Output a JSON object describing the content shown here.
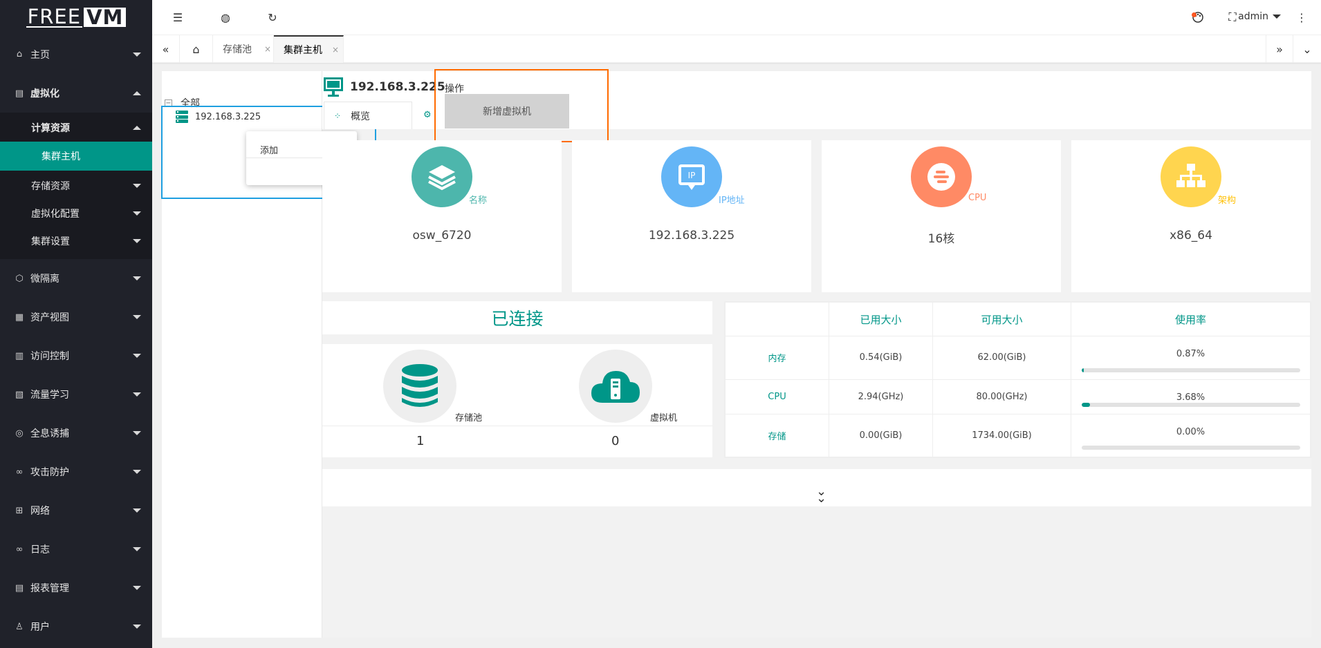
{
  "brand": {
    "part1": "FREE",
    "part2": "VM"
  },
  "sidebar": {
    "items": [
      {
        "label": "主页",
        "icon": "home-icon"
      },
      {
        "label": "虚拟化",
        "icon": "server-icon",
        "expanded": true
      },
      {
        "label": "微隔离",
        "icon": "cube-icon"
      },
      {
        "label": "资产视图",
        "icon": "assets-icon"
      },
      {
        "label": "访问控制",
        "icon": "grid-icon"
      },
      {
        "label": "流量学习",
        "icon": "flow-icon"
      },
      {
        "label": "全息诱捕",
        "icon": "trap-icon"
      },
      {
        "label": "攻击防护",
        "icon": "binoculars-icon"
      },
      {
        "label": "网络",
        "icon": "network-icon"
      },
      {
        "label": "日志",
        "icon": "infinity-icon"
      },
      {
        "label": "报表管理",
        "icon": "report-icon"
      },
      {
        "label": "用户",
        "icon": "user-icon"
      }
    ],
    "sub": {
      "compute": "计算资源",
      "cluster_host": "集群主机",
      "storage": "存储资源",
      "virt_config": "虚拟化配置",
      "cluster_settings": "集群设置"
    }
  },
  "header": {
    "user": "admin"
  },
  "tabs": {
    "items": [
      {
        "label": "存储池",
        "active": false
      },
      {
        "label": "集群主机",
        "active": true
      }
    ],
    "close_glyph": "×"
  },
  "tree": {
    "root": "全部",
    "node": "192.168.3.225",
    "context_menu": {
      "add": "添加"
    }
  },
  "main": {
    "host_title": "192.168.3.225",
    "overview_tab": "概览",
    "operation": {
      "label": "操作",
      "button": "新增虚拟机"
    },
    "cards": [
      {
        "label": "名称",
        "value": "osw_6720",
        "color": "#4db6ac"
      },
      {
        "label": "IP地址",
        "value": "192.168.3.225",
        "color": "#64b5f6"
      },
      {
        "label": "CPU",
        "value": "16核",
        "color": "#ff8a65"
      },
      {
        "label": "架构",
        "value": "x86_64",
        "color": "#ffd54f"
      }
    ],
    "status": "已连接",
    "resources": [
      {
        "label": "存储池",
        "count": "1"
      },
      {
        "label": "虚拟机",
        "count": "0"
      }
    ],
    "usage": {
      "headers": [
        "",
        "已用大小",
        "可用大小",
        "使用率"
      ],
      "rows": [
        {
          "name": "内存",
          "used": "0.54(GiB)",
          "avail": "62.00(GiB)",
          "rate": "0.87%",
          "fraction": 0.0087
        },
        {
          "name": "CPU",
          "used": "2.94(GHz)",
          "avail": "80.00(GHz)",
          "rate": "3.68%",
          "fraction": 0.0368
        },
        {
          "name": "存储",
          "used": "0.00(GiB)",
          "avail": "1734.00(GiB)",
          "rate": "0.00%",
          "fraction": 0
        }
      ]
    }
  },
  "colors": {
    "accent": "#009688",
    "sidebar_bg": "#20222a",
    "highlight_box": "#ff6a00",
    "selection_box": "#1e9fe0"
  }
}
